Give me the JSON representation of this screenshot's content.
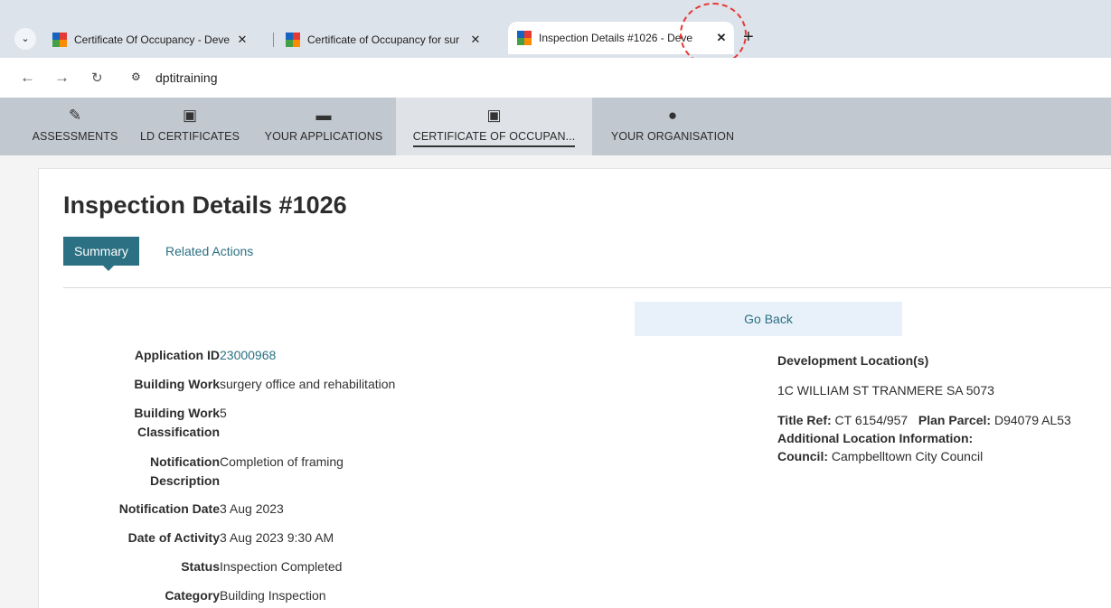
{
  "browser": {
    "tabs": [
      {
        "title": "Certificate Of Occupancy - Deve",
        "close": "✕"
      },
      {
        "title": "Certificate of Occupancy for sur",
        "close": "✕"
      },
      {
        "title": "Inspection Details #1026 - Deve",
        "close": "✕"
      }
    ],
    "new_tab": "+",
    "url": "dptitraining"
  },
  "nav": {
    "items": [
      {
        "label": "ASSESSMENTS",
        "icon": "edit-icon"
      },
      {
        "label": "LD CERTIFICATES",
        "icon": "id-card-icon"
      },
      {
        "label": "YOUR APPLICATIONS",
        "icon": "archive-icon"
      },
      {
        "label": "CERTIFICATE OF OCCUPAN...",
        "icon": "id-card-icon"
      },
      {
        "label": "YOUR ORGANISATION",
        "icon": "user-icon"
      }
    ]
  },
  "page": {
    "title": "Inspection Details #1026",
    "tabs": [
      {
        "label": "Summary"
      },
      {
        "label": "Related Actions"
      }
    ],
    "go_back": "Go Back"
  },
  "details": {
    "application_id": {
      "label": "Application ID",
      "value": "23000968"
    },
    "building_work": {
      "label": "Building Work",
      "value": "surgery office and rehabilitation"
    },
    "classification": {
      "label1": "Building Work",
      "label2": "Classification",
      "value": "5"
    },
    "notification_description": {
      "label1": "Notification",
      "label2": "Description",
      "value": "Completion of framing"
    },
    "notification_date": {
      "label": "Notification Date",
      "value": "3 Aug 2023"
    },
    "date_of_activity": {
      "label": "Date of Activity",
      "value": "3 Aug 2023 9:30 AM"
    },
    "status": {
      "label": "Status",
      "value": "Inspection Completed"
    },
    "category": {
      "label": "Category",
      "value": "Building Inspection"
    }
  },
  "location": {
    "heading": "Development Location(s)",
    "address": "1C WILLIAM ST TRANMERE SA 5073",
    "title_ref_label": "Title Ref:",
    "title_ref_value": "CT 6154/957",
    "plan_parcel_label": "Plan Parcel:",
    "plan_parcel_value": "D94079 AL53",
    "additional_label": "Additional Location Information:",
    "council_label": "Council:",
    "council_value": "Campbelltown City Council"
  },
  "colors": {
    "accent": "#2b7083",
    "callout": "#e53935"
  }
}
